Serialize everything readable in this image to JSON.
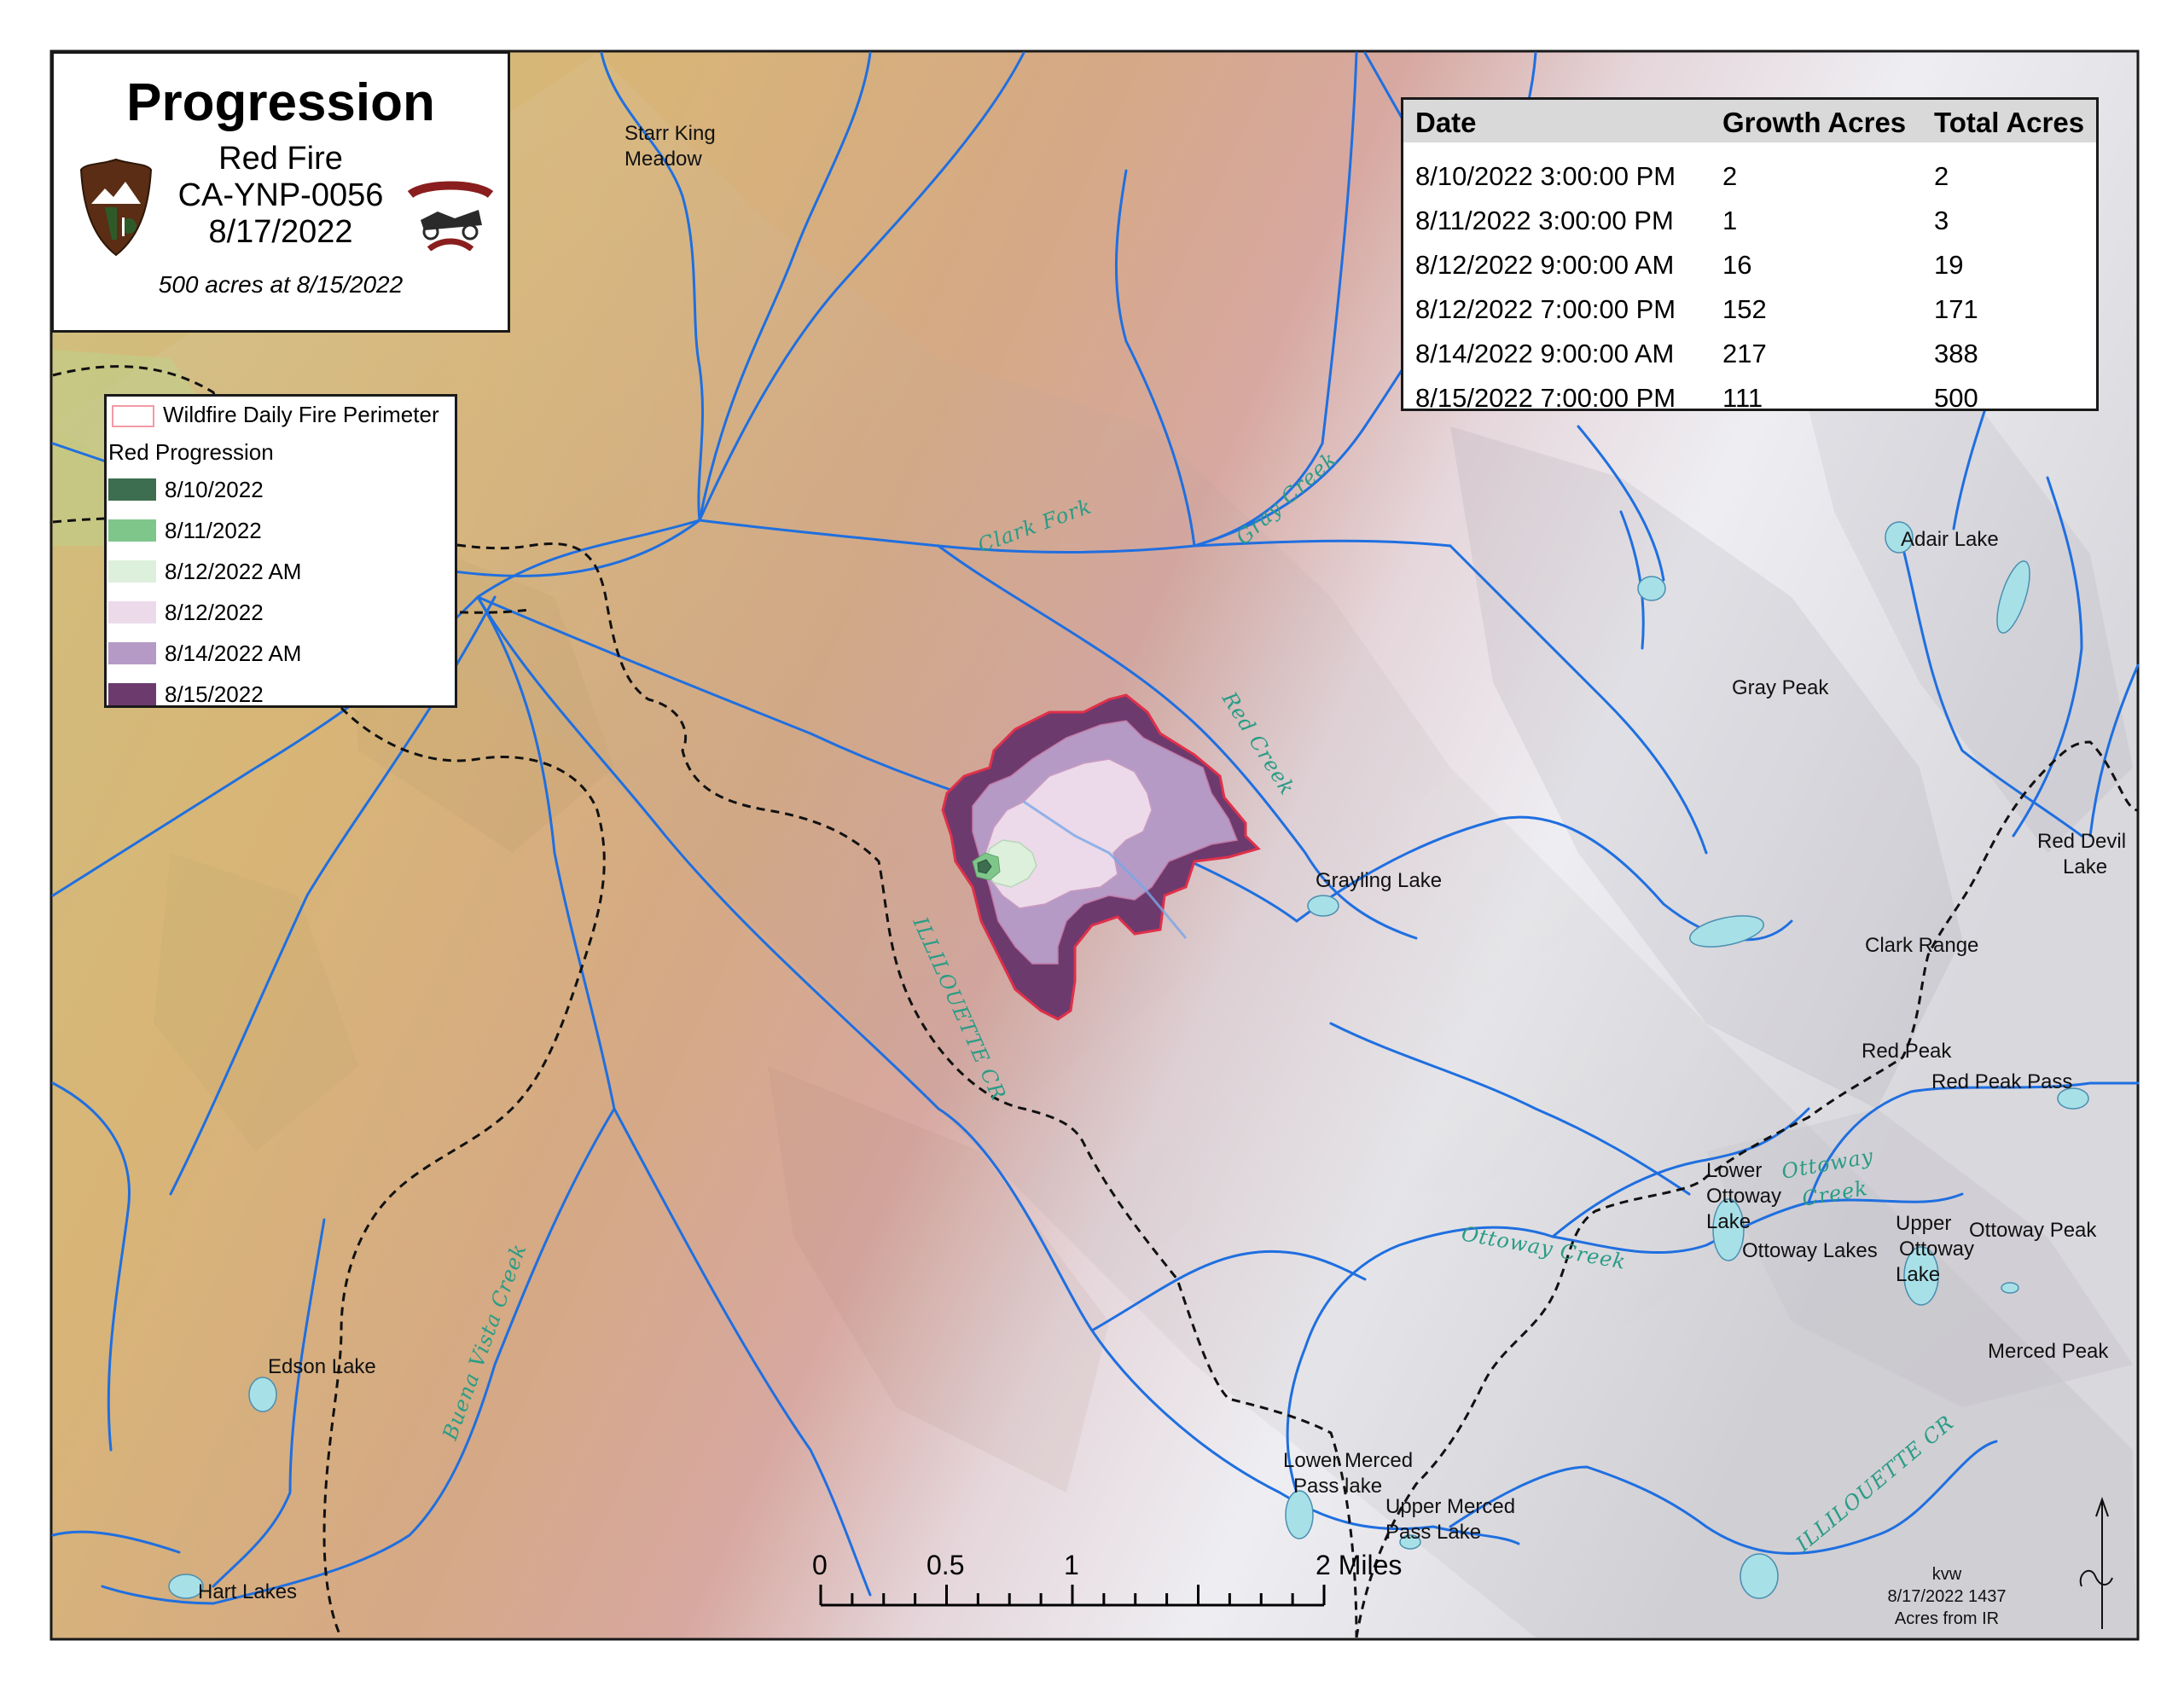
{
  "title": {
    "heading": "Progression",
    "fire_name": "Red Fire",
    "incident_id": "CA-YNP-0056",
    "date": "8/17/2022",
    "note": "500 acres at 8/15/2022",
    "logo_left": "NATIONAL PARK SERVICE",
    "logo_right": "YOSEMITE FIRE"
  },
  "legend": {
    "perimeter_label": "Wildfire Daily Fire Perimeter",
    "group_title": "Red Progression",
    "items": [
      {
        "label": "8/10/2022",
        "color": "#3c6e4f"
      },
      {
        "label": "8/11/2022",
        "color": "#7fc68b"
      },
      {
        "label": "8/12/2022 AM",
        "color": "#ddf0dc"
      },
      {
        "label": "8/12/2022",
        "color": "#ecdaea"
      },
      {
        "label": "8/14/2022 AM",
        "color": "#b59ac6"
      },
      {
        "label": "8/15/2022",
        "color": "#6d3a6e"
      }
    ]
  },
  "table": {
    "headers": [
      "Date",
      "Growth Acres",
      "Total Acres"
    ],
    "rows": [
      [
        "8/10/2022 3:00:00 PM",
        "2",
        "2"
      ],
      [
        "8/11/2022 3:00:00 PM",
        "1",
        "3"
      ],
      [
        "8/12/2022 9:00:00 AM",
        "16",
        "19"
      ],
      [
        "8/12/2022 7:00:00 PM",
        "152",
        "171"
      ],
      [
        "8/14/2022 9:00:00 AM",
        "217",
        "388"
      ],
      [
        "8/15/2022 7:00:00 PM",
        "111",
        "500"
      ]
    ]
  },
  "places": {
    "starr_king_1": "Starr King",
    "starr_king_2": "Meadow",
    "adair_lake": "Adair Lake",
    "gray_peak": "Gray Peak",
    "grayling_lake": "Grayling Lake",
    "red_devil_1": "Red Devil",
    "red_devil_2": "Lake",
    "clark_range": "Clark Range",
    "red_peak": "Red Peak",
    "red_peak_pass": "Red Peak Pass",
    "lower_ottoway_1": "Lower",
    "lower_ottoway_2": "Ottoway",
    "lower_ottoway_3": "Lake",
    "ottoway_lakes": "Ottoway Lakes",
    "upper_ottoway_1": "Upper",
    "upper_ottoway_2": "Ottoway",
    "upper_ottoway_3": "Lake",
    "ottoway_peak": "Ottoway Peak",
    "merced_peak": "Merced Peak",
    "edson_lake": "Edson Lake",
    "hart_lakes": "Hart Lakes",
    "lower_merced_1": "Lower Merced",
    "lower_merced_2": "Pass lake",
    "upper_merced_1": "Upper Merced",
    "upper_merced_2": "Pass Lake"
  },
  "streams": {
    "clark_fork": "Clark Fork",
    "gray_creek": "Gray Creek",
    "red_creek": "Red Creek",
    "illilouette_1": "ILLILOUETTE CR",
    "ottoway_creek_1": "Ottoway",
    "ottoway_creek_2": "Creek",
    "ottoway_creek_main": "Ottoway Creek",
    "buena_vista": "Buena Vista Creek",
    "illilouette_2": "ILLILOUETTE CR"
  },
  "scale_bar": {
    "ticks": [
      "0",
      "0.5",
      "1",
      "2 Miles"
    ],
    "max_miles": 2
  },
  "credit": {
    "line1": "kvw",
    "line2": "8/17/2022 1437",
    "line3": "Acres from IR"
  },
  "colors": {
    "terrain_low": "#d9b873",
    "terrain_mid": "#d6a88f",
    "terrain_high": "#eceaf0",
    "streams": "#1f6fe0",
    "lakes": "#a8e0e8",
    "trail": "#111111",
    "perimeter": "#e0304a"
  }
}
